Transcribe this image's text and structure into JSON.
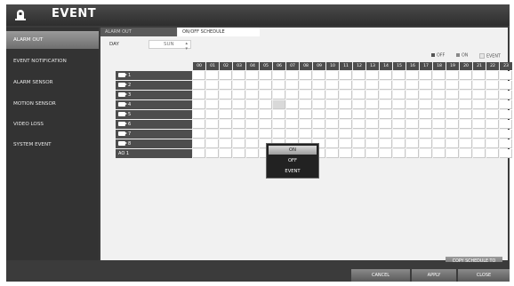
{
  "window": {
    "title": "EVENT",
    "icon": "alarm-bell-icon"
  },
  "sidebar": {
    "items": [
      {
        "label": "ALARM OUT",
        "active": true
      },
      {
        "label": "EVENT NOTIFICATION",
        "active": false
      },
      {
        "label": "ALARM SENSOR",
        "active": false
      },
      {
        "label": "MOTION SENSOR",
        "active": false
      },
      {
        "label": "VIDEO LOSS",
        "active": false
      },
      {
        "label": "SYSTEM EVENT",
        "active": false
      }
    ]
  },
  "tabs": [
    {
      "label": "ALARM OUT",
      "active": false
    },
    {
      "label": "ON/OFF SCHEDULE",
      "active": true
    }
  ],
  "day": {
    "label": "DAY",
    "value": "SUN"
  },
  "legend": [
    {
      "label": "OFF",
      "color": "#555555"
    },
    {
      "label": "ON",
      "color": "#888888"
    },
    {
      "label": "EVENT",
      "color": "#e6e6e6"
    }
  ],
  "hours": [
    "00",
    "01",
    "02",
    "03",
    "04",
    "05",
    "06",
    "07",
    "08",
    "09",
    "10",
    "11",
    "12",
    "13",
    "14",
    "15",
    "16",
    "17",
    "18",
    "19",
    "20",
    "21",
    "22",
    "23"
  ],
  "rows": [
    {
      "label": "1",
      "icon": "camera-icon"
    },
    {
      "label": "2",
      "icon": "camera-icon"
    },
    {
      "label": "3",
      "icon": "camera-icon"
    },
    {
      "label": "4",
      "icon": "camera-icon"
    },
    {
      "label": "5",
      "icon": "camera-icon"
    },
    {
      "label": "6",
      "icon": "camera-icon"
    },
    {
      "label": "7",
      "icon": "camera-icon"
    },
    {
      "label": "8",
      "icon": "camera-icon"
    },
    {
      "label": "AO 1",
      "icon": ""
    }
  ],
  "popup": {
    "options": [
      "ON",
      "OFF",
      "EVENT"
    ],
    "selected": "ON"
  },
  "buttons": {
    "copy_schedule": "COPY SCHEDULE TO",
    "cancel": "CANCEL",
    "apply": "APPLY",
    "close": "CLOSE"
  }
}
